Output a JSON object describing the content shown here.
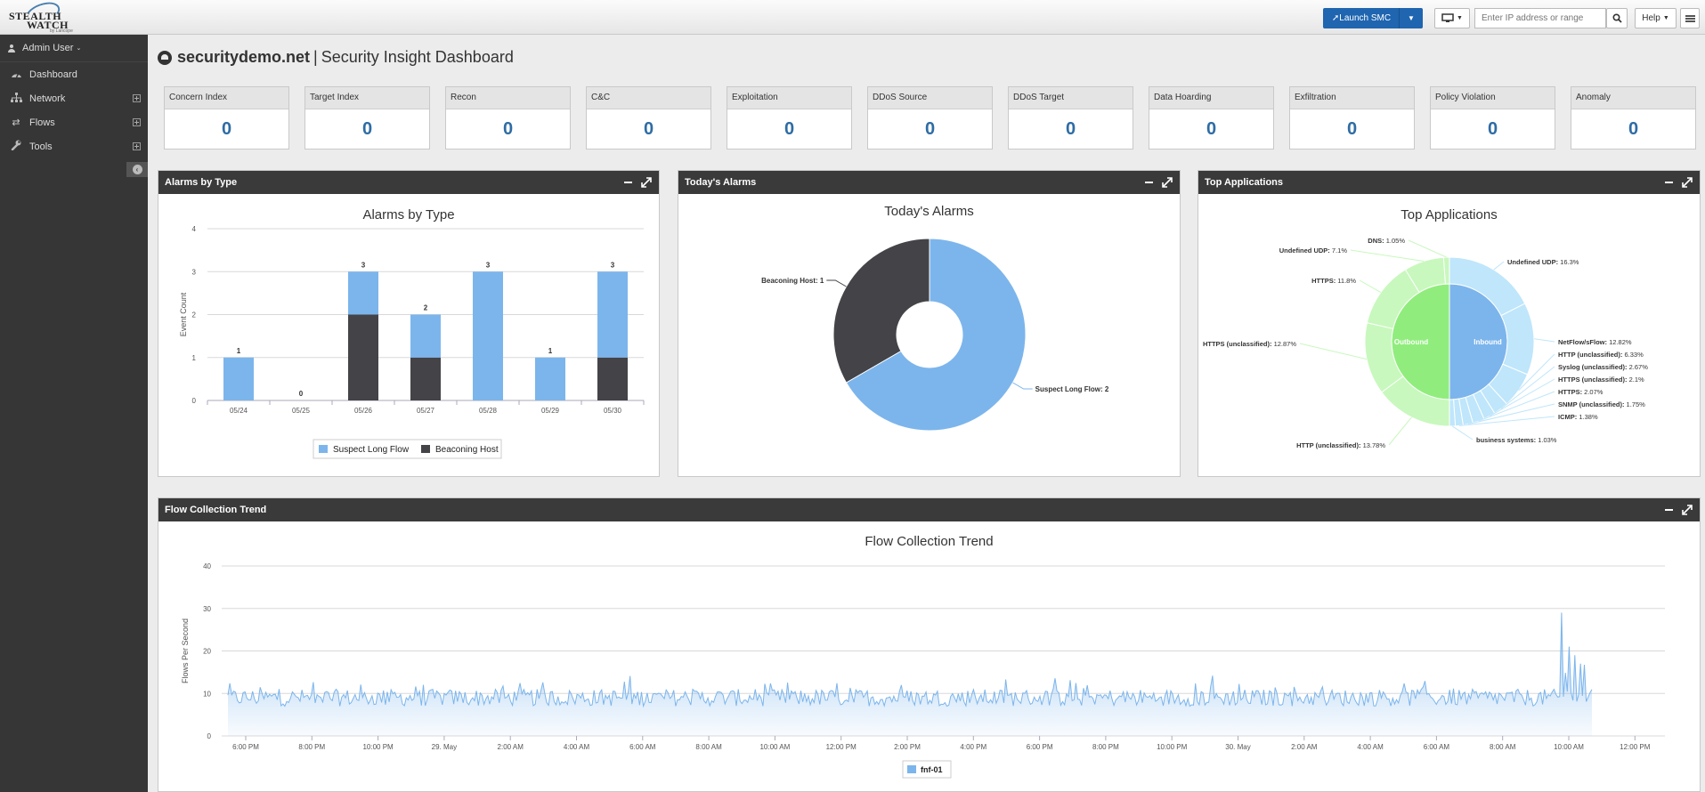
{
  "header": {
    "logo_line1": "STEALTH",
    "logo_line2": "WATCH",
    "logo_line3": "by Lancope",
    "launch_label": "Launch SMC",
    "search_placeholder": "Enter IP address or range",
    "help_label": "Help"
  },
  "sidebar": {
    "user_label": "Admin User",
    "items": [
      {
        "label": "Dashboard",
        "icon": "dashboard-icon"
      },
      {
        "label": "Network",
        "icon": "network-icon"
      },
      {
        "label": "Flows",
        "icon": "flows-icon"
      },
      {
        "label": "Tools",
        "icon": "wrench-icon"
      }
    ]
  },
  "page": {
    "domain": "securitydemo.net",
    "separator": "|",
    "title": "Security Insight Dashboard"
  },
  "kpis": [
    {
      "label": "Concern Index",
      "value": "0"
    },
    {
      "label": "Target Index",
      "value": "0"
    },
    {
      "label": "Recon",
      "value": "0"
    },
    {
      "label": "C&C",
      "value": "0"
    },
    {
      "label": "Exploitation",
      "value": "0"
    },
    {
      "label": "DDoS Source",
      "value": "0"
    },
    {
      "label": "DDoS Target",
      "value": "0"
    },
    {
      "label": "Data Hoarding",
      "value": "0"
    },
    {
      "label": "Exfiltration",
      "value": "0"
    },
    {
      "label": "Policy Violation",
      "value": "0"
    },
    {
      "label": "Anomaly",
      "value": "0"
    }
  ],
  "panels": {
    "alarms_by_type": {
      "header": "Alarms by Type",
      "title": "Alarms by Type"
    },
    "todays_alarms": {
      "header": "Today's Alarms",
      "title": "Today's Alarms"
    },
    "top_apps": {
      "header": "Top Applications",
      "title": "Top Applications"
    },
    "flow_trend": {
      "header": "Flow Collection Trend",
      "title": "Flow Collection Trend"
    }
  },
  "colors": {
    "blue": "#7cb5ec",
    "dark": "#434348",
    "green_inner": "#90ed7d",
    "green_outer": "#c8f8bd",
    "blue_outer": "#bfe6fb",
    "kpi_value": "#2e6ca4"
  },
  "chart_data": [
    {
      "type": "bar",
      "title": "Alarms by Type",
      "ylabel": "Event Count",
      "categories": [
        "05/24",
        "05/25",
        "05/26",
        "05/27",
        "05/28",
        "05/29",
        "05/30"
      ],
      "ylim": [
        0,
        4
      ],
      "yticks": [
        0,
        1,
        2,
        3,
        4
      ],
      "stacked": true,
      "series": [
        {
          "name": "Suspect Long Flow",
          "values": [
            1,
            0,
            1,
            1,
            3,
            1,
            2
          ]
        },
        {
          "name": "Beaconing Host",
          "values": [
            0,
            0,
            2,
            1,
            0,
            0,
            1
          ]
        }
      ],
      "totals": [
        1,
        0,
        3,
        2,
        3,
        1,
        3
      ],
      "legend": "bottom"
    },
    {
      "type": "pie",
      "title": "Today's Alarms",
      "donut": true,
      "slices": [
        {
          "label": "Suspect Long Flow",
          "value": 2,
          "text": "Suspect Long Flow: 2"
        },
        {
          "label": "Beaconing Host",
          "value": 1,
          "text": "Beaconing Host: 1"
        }
      ]
    },
    {
      "type": "pie",
      "title": "Top Applications",
      "inner": [
        {
          "label": "Outbound",
          "value": 50
        },
        {
          "label": "Inbound",
          "value": 50
        }
      ],
      "outbound": [
        {
          "name": "DNS",
          "pct": "1.05%",
          "value": 1.05
        },
        {
          "name": "Undefined UDP",
          "pct": "7.1%",
          "value": 7.1
        },
        {
          "name": "HTTPS",
          "pct": "11.8%",
          "value": 11.8
        },
        {
          "name": "HTTPS (unclassified)",
          "pct": "12.87%",
          "value": 12.87
        },
        {
          "name": "HTTP (unclassified)",
          "pct": "13.78%",
          "value": 13.78
        }
      ],
      "inbound": [
        {
          "name": "Undefined UDP",
          "pct": "16.3%",
          "value": 16.3
        },
        {
          "name": "NetFlow/sFlow",
          "pct": "12.82%",
          "value": 12.82
        },
        {
          "name": "HTTP (unclassified)",
          "pct": "6.33%",
          "value": 6.33
        },
        {
          "name": "Syslog (unclassified)",
          "pct": "2.67%",
          "value": 2.67
        },
        {
          "name": "HTTPS (unclassified)",
          "pct": "2.1%",
          "value": 2.1
        },
        {
          "name": "HTTPS",
          "pct": "2.07%",
          "value": 2.07
        },
        {
          "name": "SNMP (unclassified)",
          "pct": "1.75%",
          "value": 1.75
        },
        {
          "name": "ICMP",
          "pct": "1.38%",
          "value": 1.38
        },
        {
          "name": "business systems",
          "pct": "1.03%",
          "value": 1.03
        }
      ]
    },
    {
      "type": "area",
      "title": "Flow Collection Trend",
      "ylabel": "Flows Per Second",
      "ylim": [
        0,
        40
      ],
      "yticks": [
        0,
        10,
        20,
        30,
        40
      ],
      "xticks": [
        "6:00 PM",
        "8:00 PM",
        "10:00 PM",
        "29. May",
        "2:00 AM",
        "4:00 AM",
        "6:00 AM",
        "8:00 AM",
        "10:00 AM",
        "12:00 PM",
        "2:00 PM",
        "4:00 PM",
        "6:00 PM",
        "8:00 PM",
        "10:00 PM",
        "30. May",
        "2:00 AM",
        "4:00 AM",
        "6:00 AM",
        "8:00 AM",
        "10:00 AM",
        "12:00 PM"
      ],
      "series": [
        {
          "name": "fnf-01",
          "typical_min": 7,
          "typical_max": 11,
          "peak": 29
        }
      ],
      "legend": "bottom"
    }
  ]
}
